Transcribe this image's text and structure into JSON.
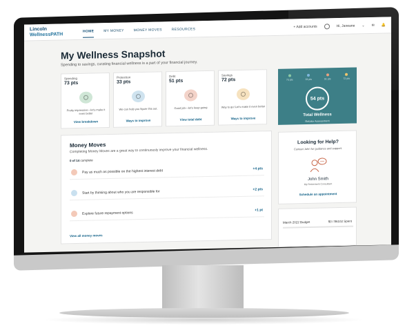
{
  "app": {
    "logo_line1": "Lincoln",
    "logo_line2": "WellnessPATH",
    "nav": [
      {
        "label": "HOME",
        "active": true
      },
      {
        "label": "MY MONEY",
        "active": false
      },
      {
        "label": "MONEY MOVES",
        "active": false
      },
      {
        "label": "RESOURCES",
        "active": false
      }
    ],
    "add_accounts": "+ Add accounts",
    "greeting": "Hi, Janeane"
  },
  "header": {
    "title": "My Wellness Snapshot",
    "subtitle": "Spending to savings, curating financial wellness is a part of your financial journey."
  },
  "cards": [
    {
      "category": "Spending",
      "points": "73 pts",
      "description": "Pretty impressive—let's make it even better",
      "link": "View breakdown",
      "color": "#cfe6d6",
      "icon": "piggy-bank-icon"
    },
    {
      "category": "Protection",
      "points": "33 pts",
      "description": "We can help you figure this out.",
      "link": "Ways to improve",
      "color": "#cfe3ef",
      "icon": "house-icon"
    },
    {
      "category": "Debt",
      "points": "51 pts",
      "description": "Good job—let's keep going",
      "link": "View total debt",
      "color": "#f3d3c9",
      "icon": "money-bag-icon"
    },
    {
      "category": "Savings",
      "points": "72 pts",
      "description": "Way to go! Let's make it even better",
      "link": "Ways to improve",
      "color": "#f6e2bf",
      "icon": "coins-icon"
    }
  ],
  "total": {
    "breakdown": [
      {
        "label": "73 pts",
        "color": "#8cc9a4"
      },
      {
        "label": "33 pts",
        "color": "#7fb7dd"
      },
      {
        "label": "51 pts",
        "color": "#e9a17f"
      },
      {
        "label": "72 pts",
        "color": "#f0c66d"
      }
    ],
    "score": "54 pts",
    "label": "Total Wellness",
    "retake": "Retake Assessment"
  },
  "money_moves": {
    "title": "Money Moves",
    "subtitle": "Completing Money Moves are a great way to continuously improve your financial wellness.",
    "count_bold": "0 of 14",
    "count_rest": " complete",
    "items": [
      {
        "text": "Pay as much as possible on the highest interest debt",
        "points": "+4 pts",
        "color": "#f3c9b8"
      },
      {
        "text": "Start by thinking about who you are responsible for",
        "points": "+2 pts",
        "color": "#c9e0ef"
      },
      {
        "text": "Explore future repayment options",
        "points": "+1 pt",
        "color": "#f3c9b8"
      }
    ],
    "view_all": "View all money moves"
  },
  "help": {
    "title": "Looking for Help?",
    "subtitle": "Contact John for guidance and support.",
    "advisor_name": "John Smith",
    "advisor_role": "My Retirement Consultant",
    "schedule": "Schedule an appointment"
  },
  "budget": {
    "title": "March 2022 Budget",
    "spent": "$0 / $6102 Spent"
  }
}
